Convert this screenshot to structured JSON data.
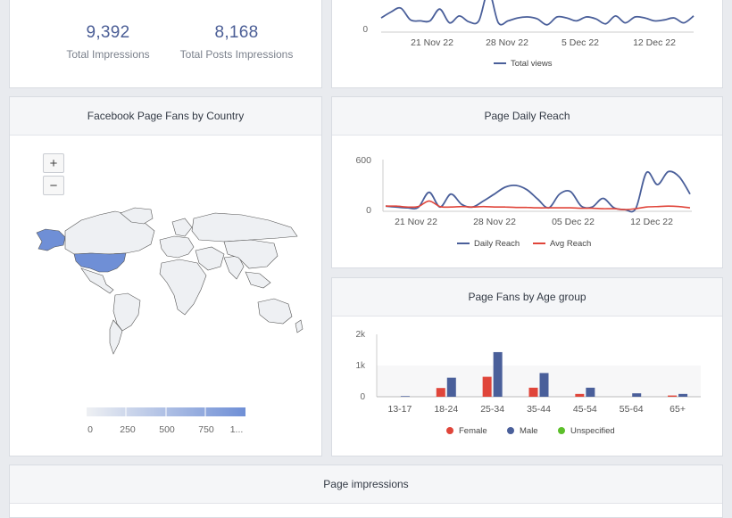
{
  "stats": {
    "total_impressions": {
      "value": "9,392",
      "label": "Total Impressions"
    },
    "total_posts_impressions": {
      "value": "8,168",
      "label": "Total Posts Impressions"
    }
  },
  "views_chart": {
    "y_tick": "0",
    "x_ticks": [
      "21 Nov 22",
      "28 Nov 22",
      "5 Dec 22",
      "12 Dec 22"
    ],
    "legend": "Total views",
    "color": "#4a5f9a"
  },
  "country_map": {
    "title": "Facebook Page Fans by Country",
    "zoom_in": "+",
    "zoom_out": "−",
    "scale_labels": [
      "0",
      "250",
      "500",
      "750",
      "1..."
    ],
    "colors": {
      "low": "#eef0f3",
      "high": "#7090d8"
    }
  },
  "daily_reach": {
    "title": "Page Daily Reach",
    "y_ticks": [
      "600",
      "0"
    ],
    "x_ticks": [
      "21 Nov 22",
      "28 Nov 22",
      "05 Dec 22",
      "12 Dec 22"
    ],
    "legend_daily": "Daily Reach",
    "legend_avg": "Avg Reach",
    "colors": {
      "daily": "#4a5f9a",
      "avg": "#e0453a"
    }
  },
  "age_group": {
    "title": "Page Fans by Age group",
    "y_ticks": [
      "2k",
      "1k",
      "0"
    ],
    "categories": [
      "13-17",
      "18-24",
      "25-34",
      "35-44",
      "45-54",
      "55-64",
      "65+"
    ],
    "legend_female": "Female",
    "legend_male": "Male",
    "legend_unspecified": "Unspecified",
    "colors": {
      "female": "#e0453a",
      "male": "#4a5f9a",
      "unspecified": "#5cbf2a"
    }
  },
  "page_impressions": {
    "title": "Page impressions"
  },
  "chart_data": [
    {
      "type": "line",
      "series": [
        {
          "name": "Total views",
          "values": [
            0.45,
            0.75,
            0.95,
            0.35,
            0.3,
            0.3,
            0.9,
            0.2,
            0.55,
            0.25,
            0.3,
            1.8,
            0.2,
            0.3,
            0.45,
            0.5,
            0.4,
            0.1,
            0.5,
            0.45,
            0.3,
            0.5,
            0.4,
            0.15,
            0.55,
            0.2,
            0.5,
            0.45,
            0.3,
            0.35,
            0.45,
            0.2,
            0.55
          ]
        }
      ],
      "x_ticks": [
        "21 Nov 22",
        "28 Nov 22",
        "5 Dec 22",
        "12 Dec 22"
      ]
    },
    {
      "type": "line",
      "ylim": [
        0,
        600
      ],
      "series": [
        {
          "name": "Daily Reach",
          "values": [
            60,
            50,
            40,
            45,
            220,
            50,
            200,
            80,
            50,
            120,
            200,
            280,
            300,
            250,
            140,
            40,
            200,
            230,
            60,
            50,
            150,
            40,
            20,
            30,
            450,
            310,
            460,
            400,
            200
          ]
        },
        {
          "name": "Avg Reach",
          "values": [
            60,
            60,
            50,
            55,
            120,
            55,
            50,
            55,
            50,
            55,
            50,
            50,
            45,
            45,
            40,
            40,
            40,
            40,
            35,
            35,
            30,
            30,
            20,
            30,
            50,
            55,
            60,
            55,
            40
          ]
        }
      ],
      "x_ticks": [
        "21 Nov 22",
        "28 Nov 22",
        "05 Dec 22",
        "12 Dec 22"
      ]
    },
    {
      "type": "bar",
      "categories": [
        "13-17",
        "18-24",
        "25-34",
        "35-44",
        "45-54",
        "55-64",
        "65+"
      ],
      "series": [
        {
          "name": "Female",
          "values": [
            0,
            280,
            640,
            290,
            90,
            0,
            40
          ]
        },
        {
          "name": "Male",
          "values": [
            20,
            610,
            1430,
            760,
            290,
            110,
            90
          ]
        },
        {
          "name": "Unspecified",
          "values": [
            0,
            0,
            0,
            0,
            0,
            0,
            0
          ]
        }
      ],
      "ylim": [
        0,
        2000
      ]
    }
  ]
}
